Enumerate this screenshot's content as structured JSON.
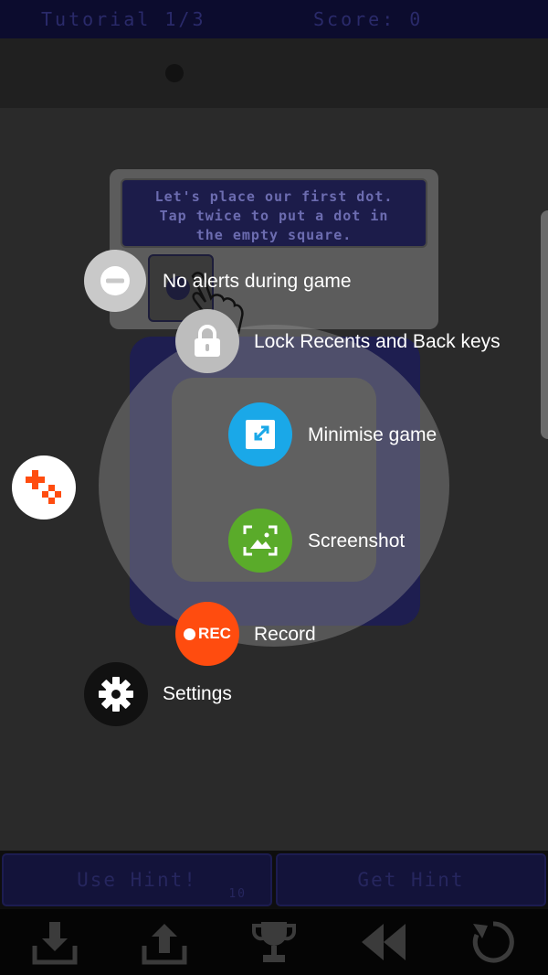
{
  "game": {
    "tutorial_label": "Tutorial 1/3",
    "score_label": "Score: 0",
    "tutorial_text": [
      "Let's place our first dot.",
      "Tap twice to put a dot in",
      "the empty square."
    ],
    "use_hint_label": "Use Hint!",
    "hint_count": "10",
    "get_hint_label": "Get Hint"
  },
  "overlay_menu": {
    "items": [
      {
        "label": "No alerts during game",
        "icon": "minus-circle-icon",
        "color": "#c9c9c9"
      },
      {
        "label": "Lock Recents and Back keys",
        "icon": "lock-icon",
        "color": "#bdbdbd"
      },
      {
        "label": "Minimise game",
        "icon": "minimise-icon",
        "color": "#1aa8e8"
      },
      {
        "label": "Screenshot",
        "icon": "screenshot-icon",
        "color": "#5aab2a"
      },
      {
        "label": "Record",
        "icon": "record-icon",
        "color": "#ff4c0f"
      },
      {
        "label": "Settings",
        "icon": "gear-icon",
        "color": "#111111"
      }
    ],
    "rec_badge": "REC"
  },
  "nav_icons": [
    "download-icon",
    "upload-icon",
    "trophy-icon",
    "rewind-icon",
    "refresh-icon"
  ],
  "colors": {
    "accent_dark_blue": "#1e1e50",
    "rec_orange": "#ff4c0f"
  }
}
